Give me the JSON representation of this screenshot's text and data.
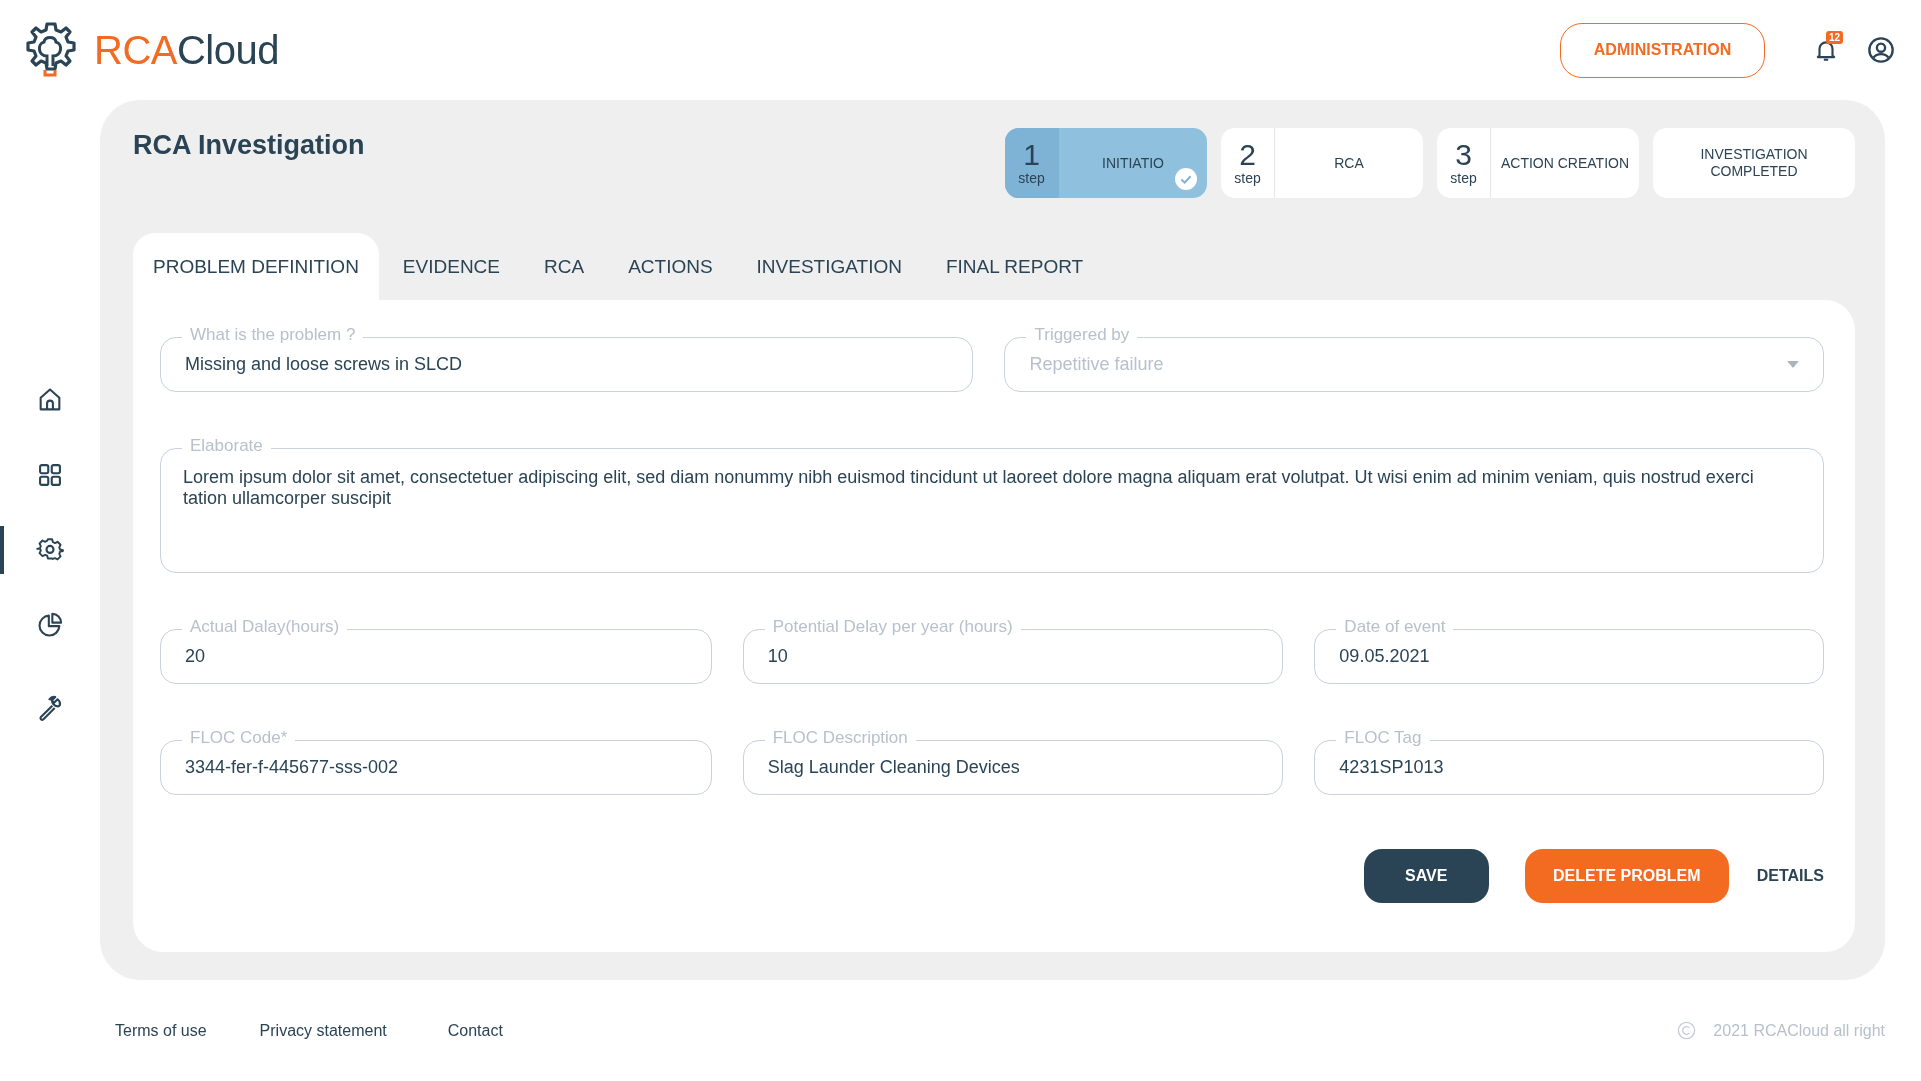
{
  "header": {
    "logo": {
      "part_1": "RCA",
      "part_2": "Cloud"
    },
    "admin_button": "ADMINISTRATION",
    "notifications": {
      "count": "12"
    }
  },
  "sidebar": {
    "items": [
      {
        "kind": "home",
        "selected": false
      },
      {
        "kind": "grid",
        "selected": false
      },
      {
        "kind": "gear",
        "selected": true
      },
      {
        "kind": "chart",
        "selected": false
      },
      {
        "kind": "wrench",
        "selected": false
      }
    ]
  },
  "page": {
    "title": "RCA Investigation",
    "steps": [
      {
        "number": "1",
        "unit": "step",
        "label": "INITIATIO",
        "selected": true,
        "completed": true
      },
      {
        "number": "2",
        "unit": "step",
        "label": "RCA",
        "selected": false,
        "completed": false
      },
      {
        "number": "3",
        "unit": "step",
        "label": "ACTION CREATION",
        "selected": false,
        "completed": false
      },
      {
        "label": "INVESTIGATION COMPLETED",
        "selected": false,
        "completed": false
      }
    ],
    "tabs": [
      {
        "label": "PROBLEM DEFINITION",
        "selected": true
      },
      {
        "label": "EVIDENCE",
        "selected": false
      },
      {
        "label": "RCA",
        "selected": false
      },
      {
        "label": "ACTIONS",
        "selected": false
      },
      {
        "label": "INVESTIGATION",
        "selected": false
      },
      {
        "label": "FINAL REPORT",
        "selected": false
      }
    ],
    "form": {
      "rows": [
        [
          {
            "kind": "text",
            "label": "What is the problem ?",
            "value": "Missing and loose screws in SLCD"
          },
          {
            "kind": "select",
            "label": "Triggered by",
            "placeholder": "Repetitive failure"
          }
        ],
        [
          {
            "kind": "textarea",
            "label": "Elaborate",
            "value": "Lorem ipsum dolor sit amet, consectetuer adipiscing elit, sed diam nonummy nibh euismod tincidunt ut laoreet dolore magna aliquam erat volutpat. Ut wisi enim ad minim veniam, quis nostrud exerci tation ullamcorper suscipit"
          }
        ],
        [
          {
            "kind": "text",
            "label": "Actual Dalay(hours)",
            "value": "20"
          },
          {
            "kind": "text",
            "label": "Potential Delay per year (hours)",
            "value": "10"
          },
          {
            "kind": "text",
            "label": "Date of event",
            "value": "09.05.2021"
          }
        ],
        [
          {
            "kind": "text",
            "label": "FLOC Code*",
            "value": "3344-fer-f-445677-sss-002"
          },
          {
            "kind": "text",
            "label": "FLOC Description",
            "value": "Slag Launder Cleaning Devices"
          },
          {
            "kind": "text",
            "label": "FLOC Tag",
            "value": "4231SP1013"
          }
        ]
      ],
      "buttons": [
        {
          "kind": "primary",
          "label": "SAVE"
        },
        {
          "kind": "danger",
          "label": "DELETE PROBLEM"
        },
        {
          "kind": "link",
          "label": "DETAILS"
        }
      ]
    }
  },
  "footer": {
    "links": [
      "Terms of use",
      "Privacy statement",
      "Contact"
    ],
    "copyright": "2021 RCACloud all right"
  }
}
